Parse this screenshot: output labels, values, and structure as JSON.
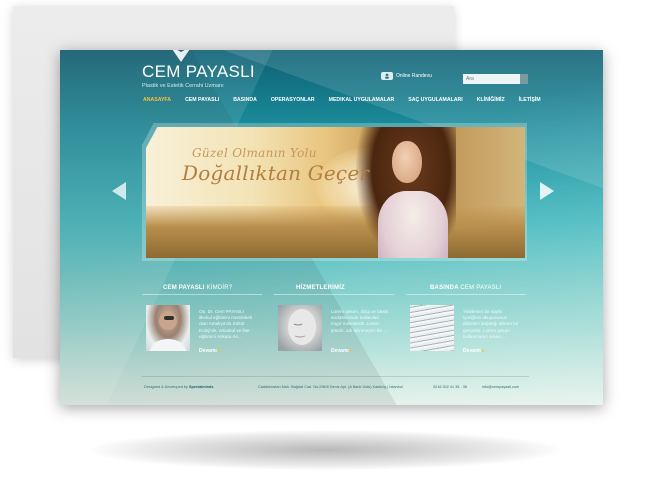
{
  "header": {
    "brand_name": "CEM PAYASLI",
    "brand_tagline": "Plastik ve Estetik Cerrahi Uzmanı",
    "appointment_label": "Online Randevu",
    "search_placeholder": "Ara"
  },
  "nav": {
    "items": [
      "ANASAYFA",
      "CEM PAYASLI",
      "BASINDA",
      "OPERASYONLAR",
      "MEDIKAL UYGULAMALAR",
      "SAÇ UYGULAMALARI",
      "KLİNİĞİMİZ",
      "İLETİŞİM"
    ],
    "active_index": 0
  },
  "slider": {
    "line1": "Güzel Olmanın Yolu",
    "line2": "Doğallıktan Geçer"
  },
  "columns": [
    {
      "title_bold": "CEM PAYASLI",
      "title_light": "KİMDİR?",
      "text": "Op. Dr. Cem PAYASLI ilkokul eğitimini memleketi olan Antakya'da Kültür Koleji'de, ortaokul ve lise eğitimini Ankara An...",
      "more": "Devamı"
    },
    {
      "title_bold": "HİZMETLERİMİZ",
      "title_light": "",
      "text": "Lorem Ipsum, dizgi ve baskı endüstrisinde kullanılan mıgır metinlerdir. Lorem Ipsum, adı bilinmeyen bir ...",
      "more": "Devamı"
    },
    {
      "title_bold": "BASINDA",
      "title_light": "CEM PAYASLI",
      "text": "Yinelenen bir sayfa içeriğinin okuyucunun dikkatini dağıttığı bilinen bir gerçektir. Lorem Ipsum kullanmanın amacı ...",
      "more": "Devamı"
    }
  ],
  "footer": {
    "credit_prefix": "Designed & Developed by",
    "credit_name": "Specialminds",
    "address": "Caddebostan Mah. Bağdat Cad. No:298/8 Deniz Apt. (A Bank Üstü) Kadıköy | İstanbul",
    "phone": "0216 302 41 35 - 36",
    "email": "info@cempayasli.com"
  },
  "colors": {
    "accent": "#f4c23a",
    "background_top": "#0d5f73",
    "background_bottom": "#dceee4"
  }
}
